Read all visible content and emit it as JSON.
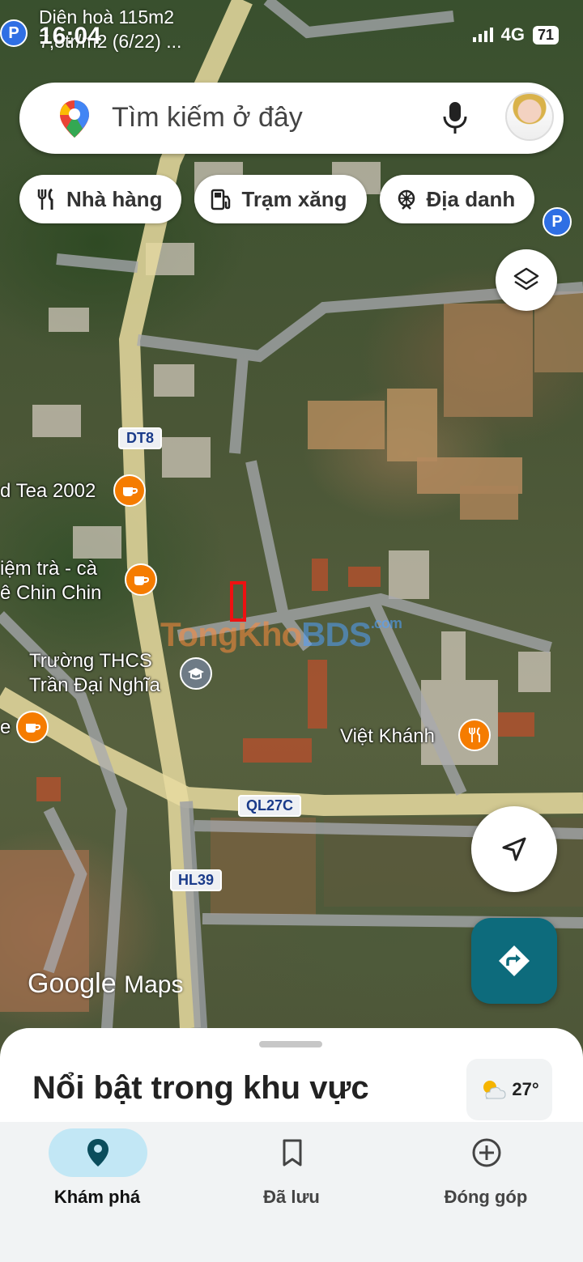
{
  "status": {
    "time": "16:04",
    "network": "4G",
    "battery": "71"
  },
  "notification": {
    "line1": "Diên hoà 115m2",
    "line2": "7,8tr/m2 (6/22) ..."
  },
  "search": {
    "placeholder": "Tìm kiếm ở đây"
  },
  "chips": [
    {
      "label": "Nhà hàng",
      "icon": "restaurant-icon"
    },
    {
      "label": "Trạm xăng",
      "icon": "gas-station-icon"
    },
    {
      "label": "Địa danh",
      "icon": "landmark-icon"
    }
  ],
  "map": {
    "road_labels": [
      "DT8",
      "QL27C",
      "HL39"
    ],
    "places": {
      "tea": "d Tea 2002",
      "cafe_line1": "iệm trà - cà",
      "cafe_line2": "ê Chin Chin",
      "school_line1": "Trường THCS",
      "school_line2": "Trần Đại Nghĩa",
      "cafe_partial": "e",
      "restaurant": "Việt Khánh"
    },
    "watermark": {
      "part1": "TongKho",
      "part2": "BDS",
      "suffix": ".com"
    },
    "logo": {
      "google": "Google",
      "maps": "Maps"
    }
  },
  "sheet": {
    "title": "Nổi bật trong khu vực",
    "temperature": "27°"
  },
  "bottom_nav": [
    {
      "label": "Khám phá",
      "icon": "explore-pin-icon",
      "active": true
    },
    {
      "label": "Đã lưu",
      "icon": "bookmark-icon",
      "active": false
    },
    {
      "label": "Đóng góp",
      "icon": "add-circle-icon",
      "active": false
    }
  ],
  "colors": {
    "accent": "#0d6b7c",
    "poi_food": "#f57c00",
    "nav_active": "#c2e7f5"
  }
}
